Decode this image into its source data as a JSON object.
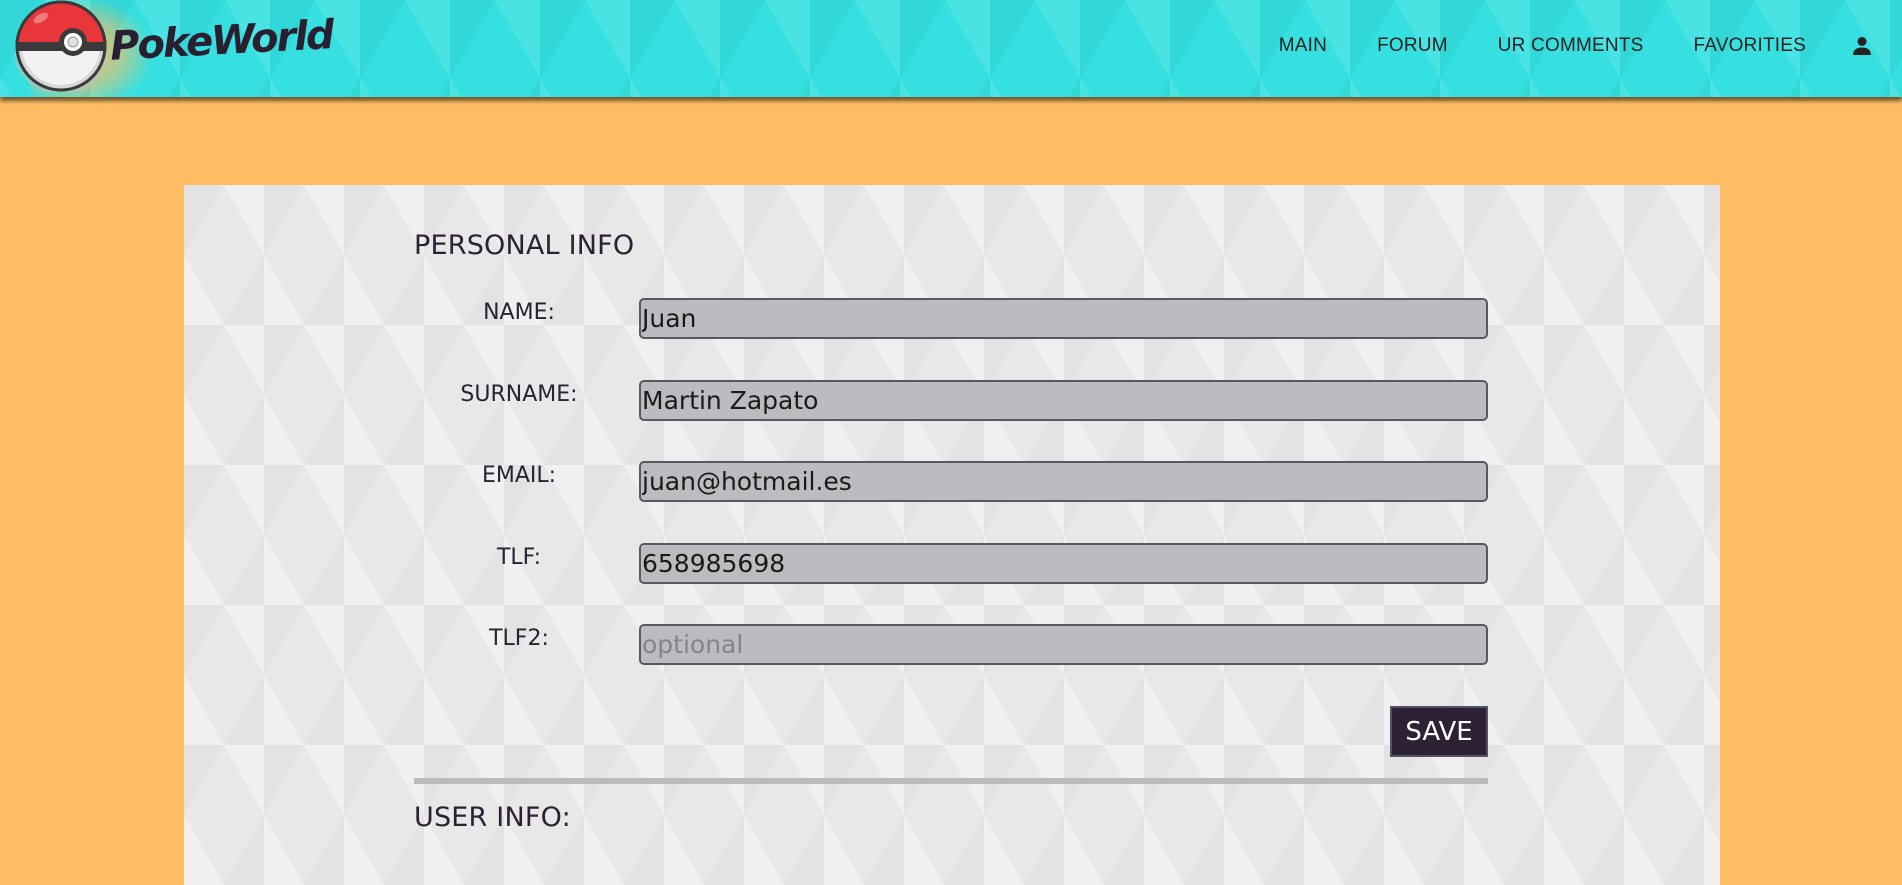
{
  "header": {
    "logo_text": "PokeWorld",
    "nav": [
      {
        "label": "MAIN"
      },
      {
        "label": "FORUM"
      },
      {
        "label": "UR COMMENTS"
      },
      {
        "label": "FAVORITIES"
      }
    ],
    "user_icon": "user-icon"
  },
  "personal_info": {
    "title": "PERSONAL INFO",
    "fields": [
      {
        "label": "NAME:",
        "value": "Juan",
        "placeholder": ""
      },
      {
        "label": "SURNAME:",
        "value": "Martin Zapato",
        "placeholder": ""
      },
      {
        "label": "EMAIL:",
        "value": "juan@hotmail.es",
        "placeholder": ""
      },
      {
        "label": "TLF:",
        "value": "658985698",
        "placeholder": ""
      },
      {
        "label": "TLF2:",
        "value": "",
        "placeholder": "optional"
      }
    ],
    "save_label": "SAVE"
  },
  "user_info": {
    "title": "USER INFO:"
  },
  "colors": {
    "page_background": "#ffbe64",
    "header_background": "#36e0e0",
    "card_background": "#e8e8e8",
    "input_background": "#bcbcc0",
    "button_background": "#2d2233"
  }
}
